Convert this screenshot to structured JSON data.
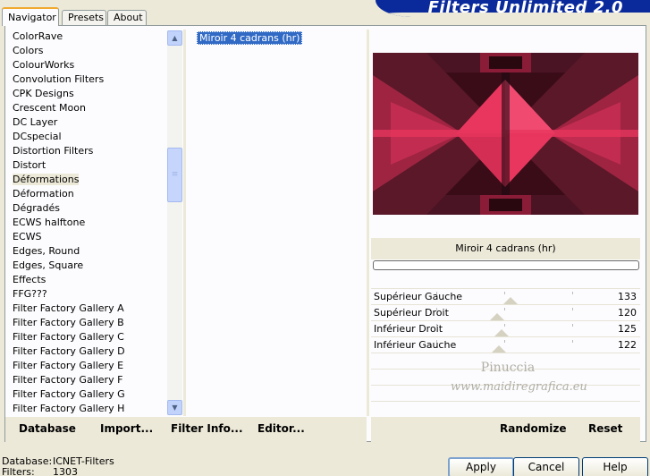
{
  "banner": {
    "title": "Filters Unlimited 2.0"
  },
  "tabs": [
    {
      "label": "Navigator",
      "active": true
    },
    {
      "label": "Presets",
      "active": false
    },
    {
      "label": "About",
      "active": false
    }
  ],
  "categories": {
    "items": [
      "ColorRave",
      "Colors",
      "ColourWorks",
      "Convolution Filters",
      "CPK Designs",
      "Crescent Moon",
      "DC Layer",
      "DCspecial",
      "Distortion Filters",
      "Distort",
      "Déformations",
      "Déformation",
      "Dégradés",
      "ECWS halftone",
      "ECWS",
      "Edges, Round",
      "Edges, Square",
      "Effects",
      "FFG???",
      "Filter Factory Gallery A",
      "Filter Factory Gallery B",
      "Filter Factory Gallery C",
      "Filter Factory Gallery D",
      "Filter Factory Gallery E",
      "Filter Factory Gallery F",
      "Filter Factory Gallery G",
      "Filter Factory Gallery H"
    ],
    "selected_index": 10
  },
  "filters": {
    "selected": "Miroir 4 cadrans (hr)"
  },
  "preview": {
    "filter_name": "Miroir 4 cadrans (hr)"
  },
  "params": [
    {
      "name": "Supérieur Gauche",
      "value": "133"
    },
    {
      "name": "Supérieur Droit",
      "value": "120"
    },
    {
      "name": "Inférieur Droit",
      "value": "125"
    },
    {
      "name": "Inférieur Gauche",
      "value": "122"
    }
  ],
  "watermark": {
    "line1": "Pinuccia",
    "line2": "www.maidiregrafica.eu"
  },
  "toolbar": {
    "database": "Database",
    "import": "Import...",
    "filter_info": "Filter Info...",
    "editor": "Editor...",
    "randomize": "Randomize",
    "reset": "Reset"
  },
  "status": {
    "database_label": "Database:",
    "database_value": "ICNET-Filters",
    "filters_label": "Filters:",
    "filters_value": "1303"
  },
  "dialog": {
    "apply": "Apply",
    "cancel": "Cancel",
    "help": "Help"
  },
  "colors": {
    "accent": "#316ac5",
    "banner": "#0a2a9c",
    "preview_pink": "#e8365e",
    "preview_dark": "#3a0c18"
  }
}
